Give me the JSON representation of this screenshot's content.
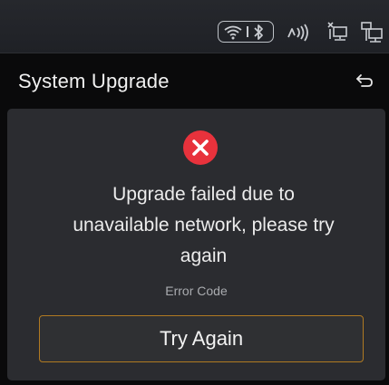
{
  "status_bar": {
    "icons": [
      "wifi-icon",
      "bluetooth-icon",
      "nfc-icon",
      "network-disconnected-icon",
      "network-icon"
    ]
  },
  "header": {
    "title": "System Upgrade",
    "back_icon": "back-arrow-icon"
  },
  "dialog": {
    "status_icon": "error-x-icon",
    "message_line1": "Upgrade failed due to",
    "message_line2": "unavailable network, please try",
    "message_line3": "again",
    "error_code_label": "Error Code",
    "button_label": "Try Again"
  },
  "colors": {
    "error_red": "#e8323c",
    "button_border": "#b07a22",
    "card_bg": "#2b2c30",
    "status_bar_bg": "#24262b"
  }
}
